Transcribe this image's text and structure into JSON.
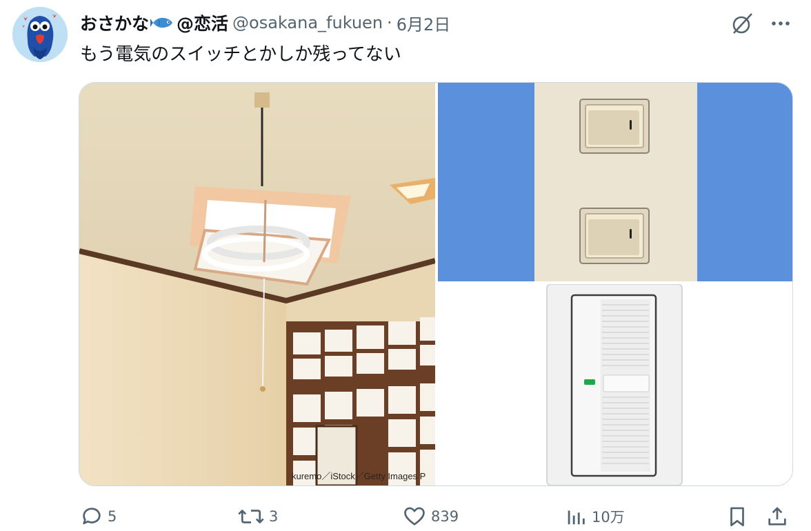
{
  "tweet": {
    "author_name": "おさかな",
    "author_name_suffix": "@恋活",
    "handle": "@osakana_fukuen",
    "separator": "·",
    "date": "6月2日",
    "text": "もう電気のスイッチとかしか残ってない"
  },
  "media": {
    "watermark": "kuremo／iStock／Getty Images P",
    "images": [
      "ceiling-lamp-photo",
      "rocker-switches-photo",
      "wide-switch-photo"
    ]
  },
  "actions": {
    "replies": "5",
    "retweets": "3",
    "likes": "839",
    "views": "10万"
  },
  "icons": [
    "grok-icon",
    "more-icon",
    "reply-icon",
    "retweet-icon",
    "like-icon",
    "views-icon",
    "bookmark-icon",
    "share-icon"
  ],
  "colors": {
    "text": "#0f1419",
    "secondary": "#536471",
    "border": "#cfd9de",
    "switch_bg_blue": "#5b90dc"
  }
}
